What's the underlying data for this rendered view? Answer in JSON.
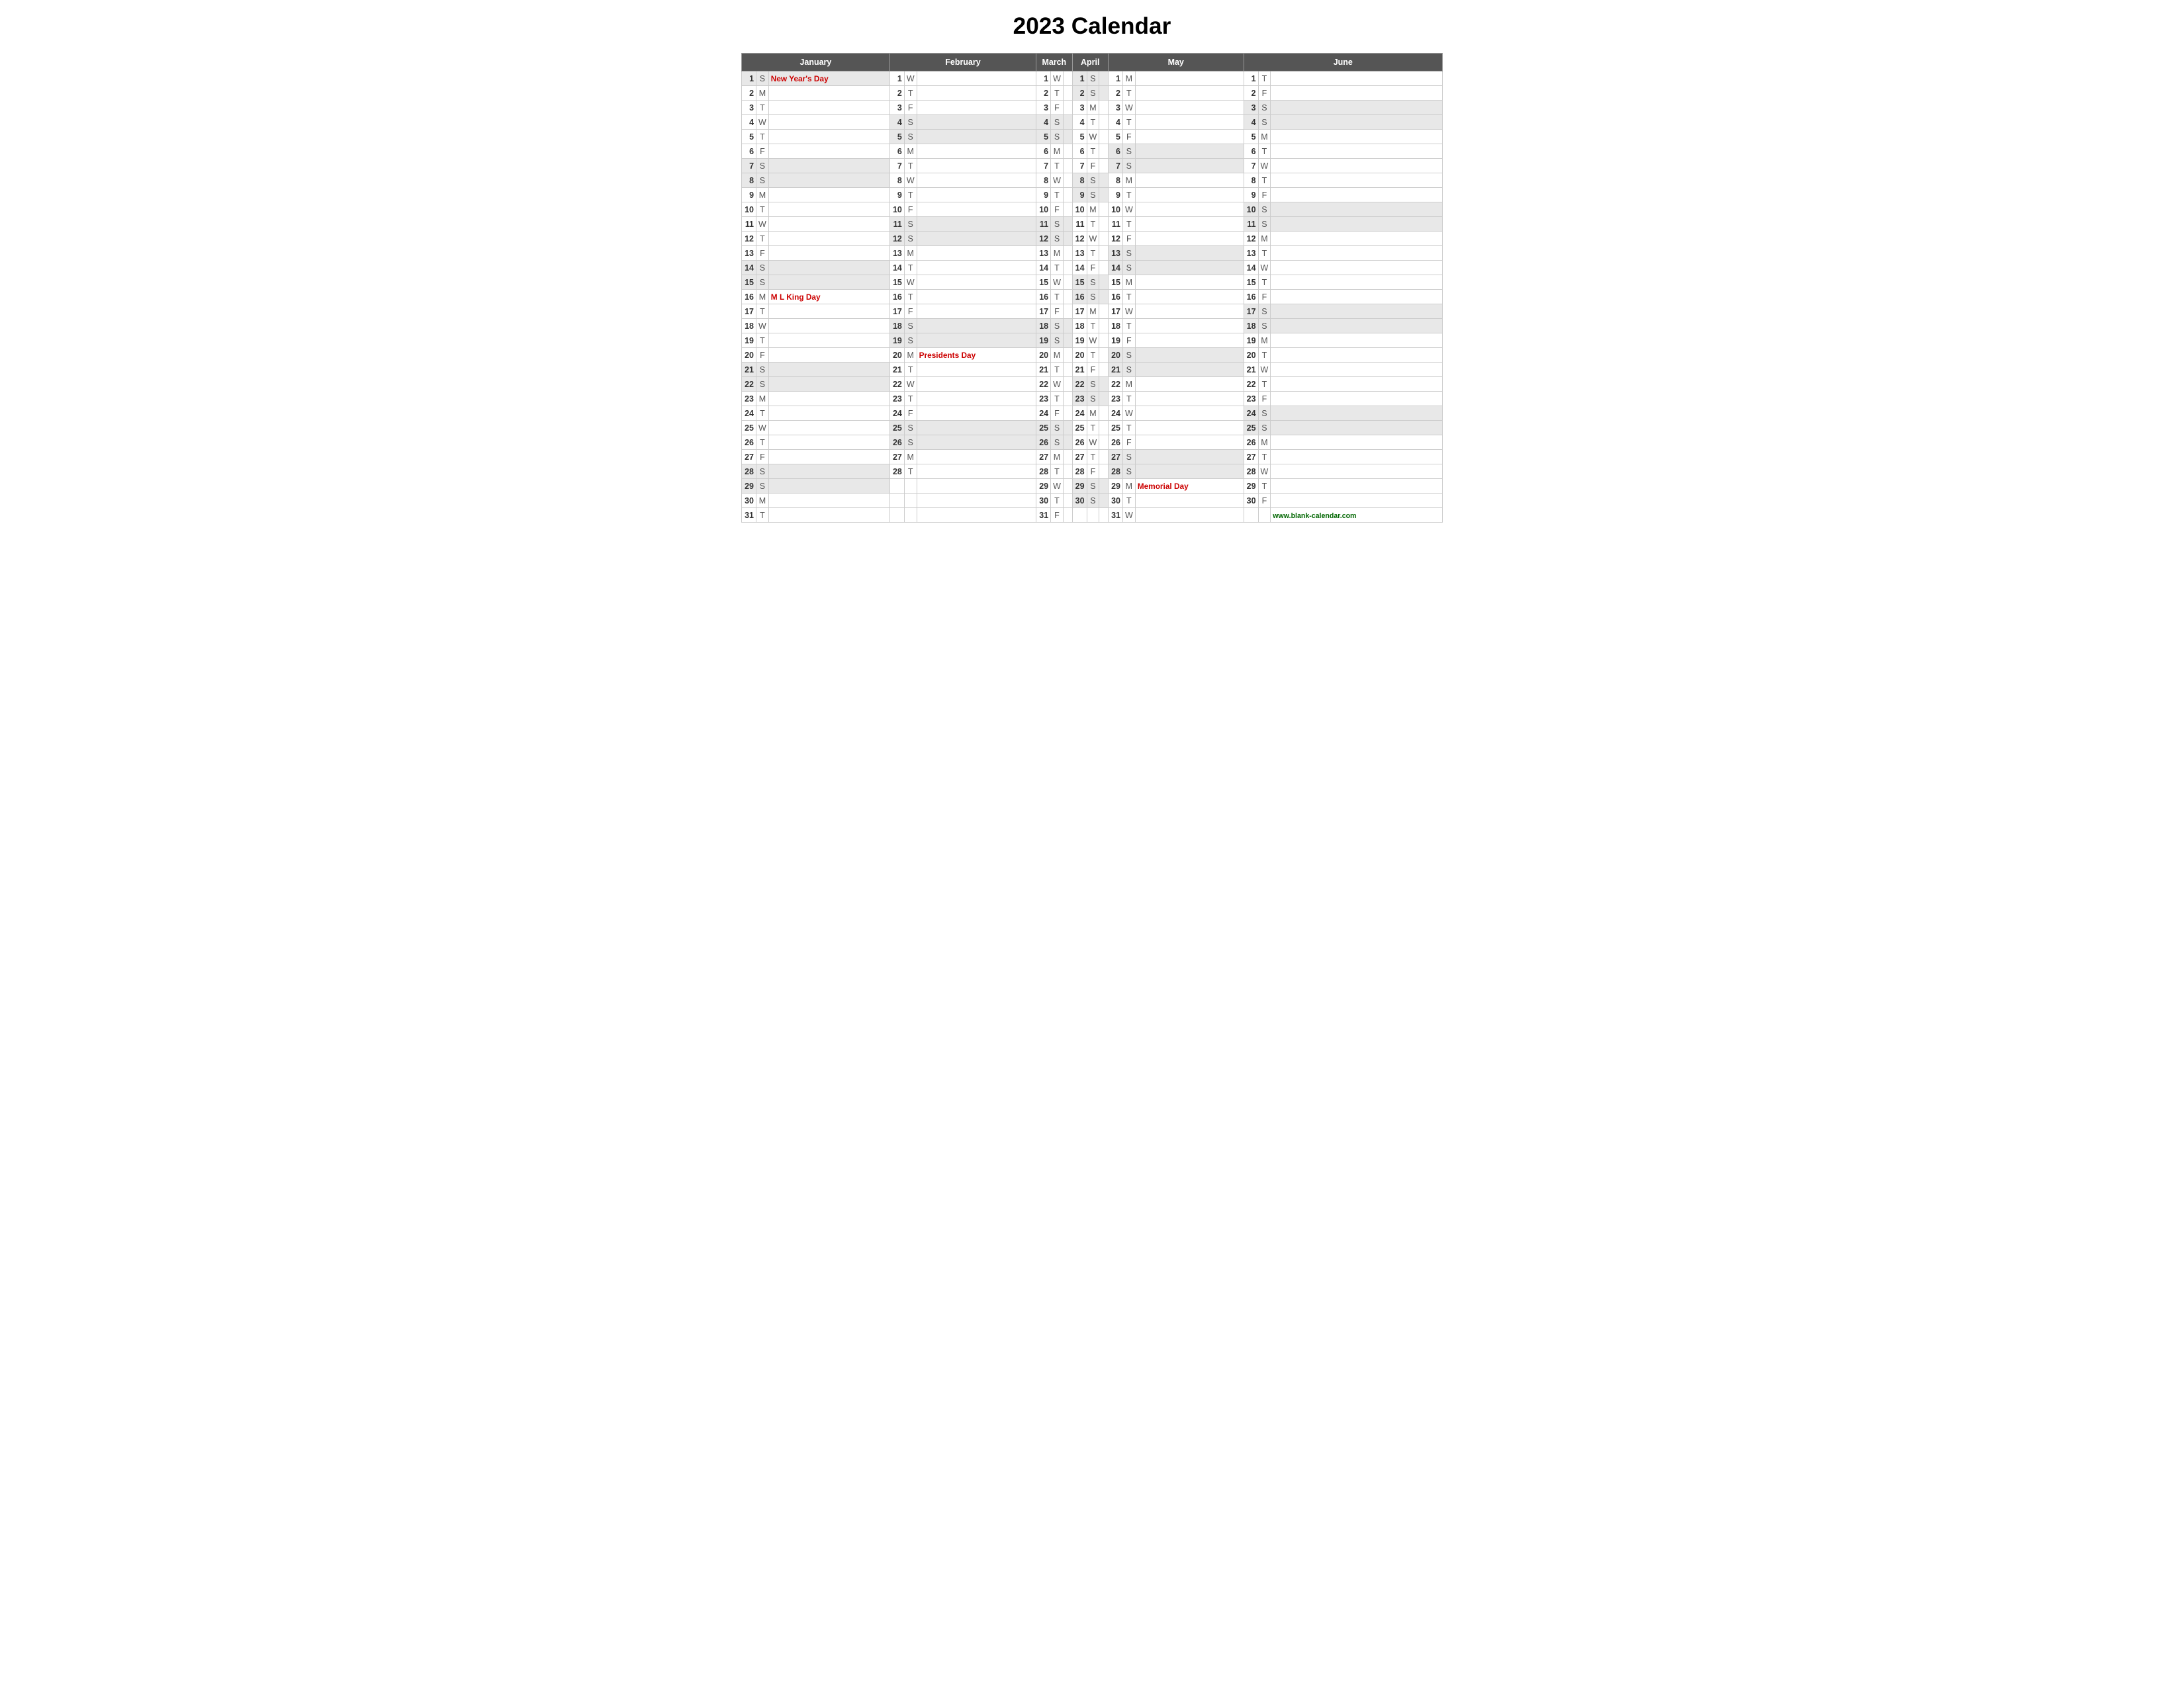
{
  "title": "2023 Calendar",
  "months": [
    "January",
    "February",
    "March",
    "April",
    "May",
    "June"
  ],
  "website": "www.blank-calendar.com",
  "days": {
    "january": [
      {
        "d": 1,
        "l": "S",
        "holiday": "New Year's Day",
        "shaded": true
      },
      {
        "d": 2,
        "l": "M",
        "holiday": "",
        "shaded": false
      },
      {
        "d": 3,
        "l": "T",
        "holiday": "",
        "shaded": false
      },
      {
        "d": 4,
        "l": "W",
        "holiday": "",
        "shaded": false
      },
      {
        "d": 5,
        "l": "T",
        "holiday": "",
        "shaded": false
      },
      {
        "d": 6,
        "l": "F",
        "holiday": "",
        "shaded": false
      },
      {
        "d": 7,
        "l": "S",
        "holiday": "",
        "shaded": true
      },
      {
        "d": 8,
        "l": "S",
        "holiday": "",
        "shaded": true
      },
      {
        "d": 9,
        "l": "M",
        "holiday": "",
        "shaded": false
      },
      {
        "d": 10,
        "l": "T",
        "holiday": "",
        "shaded": false
      },
      {
        "d": 11,
        "l": "W",
        "holiday": "",
        "shaded": false
      },
      {
        "d": 12,
        "l": "T",
        "holiday": "",
        "shaded": false
      },
      {
        "d": 13,
        "l": "F",
        "holiday": "",
        "shaded": false
      },
      {
        "d": 14,
        "l": "S",
        "holiday": "",
        "shaded": true
      },
      {
        "d": 15,
        "l": "S",
        "holiday": "",
        "shaded": true
      },
      {
        "d": 16,
        "l": "M",
        "holiday": "M L King Day",
        "shaded": false
      },
      {
        "d": 17,
        "l": "T",
        "holiday": "",
        "shaded": false
      },
      {
        "d": 18,
        "l": "W",
        "holiday": "",
        "shaded": false
      },
      {
        "d": 19,
        "l": "T",
        "holiday": "",
        "shaded": false
      },
      {
        "d": 20,
        "l": "F",
        "holiday": "",
        "shaded": false
      },
      {
        "d": 21,
        "l": "S",
        "holiday": "",
        "shaded": true
      },
      {
        "d": 22,
        "l": "S",
        "holiday": "",
        "shaded": true
      },
      {
        "d": 23,
        "l": "M",
        "holiday": "",
        "shaded": false
      },
      {
        "d": 24,
        "l": "T",
        "holiday": "",
        "shaded": false
      },
      {
        "d": 25,
        "l": "W",
        "holiday": "",
        "shaded": false
      },
      {
        "d": 26,
        "l": "T",
        "holiday": "",
        "shaded": false
      },
      {
        "d": 27,
        "l": "F",
        "holiday": "",
        "shaded": false
      },
      {
        "d": 28,
        "l": "S",
        "holiday": "",
        "shaded": true
      },
      {
        "d": 29,
        "l": "S",
        "holiday": "",
        "shaded": true
      },
      {
        "d": 30,
        "l": "M",
        "holiday": "",
        "shaded": false
      },
      {
        "d": 31,
        "l": "T",
        "holiday": "",
        "shaded": false
      }
    ],
    "february": [
      {
        "d": 1,
        "l": "W",
        "holiday": "",
        "shaded": false
      },
      {
        "d": 2,
        "l": "T",
        "holiday": "",
        "shaded": false
      },
      {
        "d": 3,
        "l": "F",
        "holiday": "",
        "shaded": false
      },
      {
        "d": 4,
        "l": "S",
        "holiday": "",
        "shaded": true
      },
      {
        "d": 5,
        "l": "S",
        "holiday": "",
        "shaded": true
      },
      {
        "d": 6,
        "l": "M",
        "holiday": "",
        "shaded": false
      },
      {
        "d": 7,
        "l": "T",
        "holiday": "",
        "shaded": false
      },
      {
        "d": 8,
        "l": "W",
        "holiday": "",
        "shaded": false
      },
      {
        "d": 9,
        "l": "T",
        "holiday": "",
        "shaded": false
      },
      {
        "d": 10,
        "l": "F",
        "holiday": "",
        "shaded": false
      },
      {
        "d": 11,
        "l": "S",
        "holiday": "",
        "shaded": true
      },
      {
        "d": 12,
        "l": "S",
        "holiday": "",
        "shaded": true
      },
      {
        "d": 13,
        "l": "M",
        "holiday": "",
        "shaded": false
      },
      {
        "d": 14,
        "l": "T",
        "holiday": "",
        "shaded": false
      },
      {
        "d": 15,
        "l": "W",
        "holiday": "",
        "shaded": false
      },
      {
        "d": 16,
        "l": "T",
        "holiday": "",
        "shaded": false
      },
      {
        "d": 17,
        "l": "F",
        "holiday": "",
        "shaded": false
      },
      {
        "d": 18,
        "l": "S",
        "holiday": "",
        "shaded": true
      },
      {
        "d": 19,
        "l": "S",
        "holiday": "",
        "shaded": true
      },
      {
        "d": 20,
        "l": "M",
        "holiday": "Presidents Day",
        "shaded": false
      },
      {
        "d": 21,
        "l": "T",
        "holiday": "",
        "shaded": false
      },
      {
        "d": 22,
        "l": "W",
        "holiday": "",
        "shaded": false
      },
      {
        "d": 23,
        "l": "T",
        "holiday": "",
        "shaded": false
      },
      {
        "d": 24,
        "l": "F",
        "holiday": "",
        "shaded": false
      },
      {
        "d": 25,
        "l": "S",
        "holiday": "",
        "shaded": true
      },
      {
        "d": 26,
        "l": "S",
        "holiday": "",
        "shaded": true
      },
      {
        "d": 27,
        "l": "M",
        "holiday": "",
        "shaded": false
      },
      {
        "d": 28,
        "l": "T",
        "holiday": "",
        "shaded": false
      }
    ],
    "march": [
      {
        "d": 1,
        "l": "W",
        "holiday": "",
        "shaded": false
      },
      {
        "d": 2,
        "l": "T",
        "holiday": "",
        "shaded": false
      },
      {
        "d": 3,
        "l": "F",
        "holiday": "",
        "shaded": false
      },
      {
        "d": 4,
        "l": "S",
        "holiday": "",
        "shaded": true
      },
      {
        "d": 5,
        "l": "S",
        "holiday": "",
        "shaded": true
      },
      {
        "d": 6,
        "l": "M",
        "holiday": "",
        "shaded": false
      },
      {
        "d": 7,
        "l": "T",
        "holiday": "",
        "shaded": false
      },
      {
        "d": 8,
        "l": "W",
        "holiday": "",
        "shaded": false
      },
      {
        "d": 9,
        "l": "T",
        "holiday": "",
        "shaded": false
      },
      {
        "d": 10,
        "l": "F",
        "holiday": "",
        "shaded": false
      },
      {
        "d": 11,
        "l": "S",
        "holiday": "",
        "shaded": true
      },
      {
        "d": 12,
        "l": "S",
        "holiday": "",
        "shaded": true
      },
      {
        "d": 13,
        "l": "M",
        "holiday": "",
        "shaded": false
      },
      {
        "d": 14,
        "l": "T",
        "holiday": "",
        "shaded": false
      },
      {
        "d": 15,
        "l": "W",
        "holiday": "",
        "shaded": false
      },
      {
        "d": 16,
        "l": "T",
        "holiday": "",
        "shaded": false
      },
      {
        "d": 17,
        "l": "F",
        "holiday": "",
        "shaded": false
      },
      {
        "d": 18,
        "l": "S",
        "holiday": "",
        "shaded": true
      },
      {
        "d": 19,
        "l": "S",
        "holiday": "",
        "shaded": true
      },
      {
        "d": 20,
        "l": "M",
        "holiday": "",
        "shaded": false
      },
      {
        "d": 21,
        "l": "T",
        "holiday": "",
        "shaded": false
      },
      {
        "d": 22,
        "l": "W",
        "holiday": "",
        "shaded": false
      },
      {
        "d": 23,
        "l": "T",
        "holiday": "",
        "shaded": false
      },
      {
        "d": 24,
        "l": "F",
        "holiday": "",
        "shaded": false
      },
      {
        "d": 25,
        "l": "S",
        "holiday": "",
        "shaded": true
      },
      {
        "d": 26,
        "l": "S",
        "holiday": "",
        "shaded": true
      },
      {
        "d": 27,
        "l": "M",
        "holiday": "",
        "shaded": false
      },
      {
        "d": 28,
        "l": "T",
        "holiday": "",
        "shaded": false
      },
      {
        "d": 29,
        "l": "W",
        "holiday": "",
        "shaded": false
      },
      {
        "d": 30,
        "l": "T",
        "holiday": "",
        "shaded": false
      },
      {
        "d": 31,
        "l": "F",
        "holiday": "",
        "shaded": false
      }
    ],
    "april": [
      {
        "d": 1,
        "l": "S",
        "holiday": "",
        "shaded": true
      },
      {
        "d": 2,
        "l": "S",
        "holiday": "",
        "shaded": true
      },
      {
        "d": 3,
        "l": "M",
        "holiday": "",
        "shaded": false
      },
      {
        "d": 4,
        "l": "T",
        "holiday": "",
        "shaded": false
      },
      {
        "d": 5,
        "l": "W",
        "holiday": "",
        "shaded": false
      },
      {
        "d": 6,
        "l": "T",
        "holiday": "",
        "shaded": false
      },
      {
        "d": 7,
        "l": "F",
        "holiday": "",
        "shaded": false
      },
      {
        "d": 8,
        "l": "S",
        "holiday": "",
        "shaded": true
      },
      {
        "d": 9,
        "l": "S",
        "holiday": "",
        "shaded": true
      },
      {
        "d": 10,
        "l": "M",
        "holiday": "",
        "shaded": false
      },
      {
        "d": 11,
        "l": "T",
        "holiday": "",
        "shaded": false
      },
      {
        "d": 12,
        "l": "W",
        "holiday": "",
        "shaded": false
      },
      {
        "d": 13,
        "l": "T",
        "holiday": "",
        "shaded": false
      },
      {
        "d": 14,
        "l": "F",
        "holiday": "",
        "shaded": false
      },
      {
        "d": 15,
        "l": "S",
        "holiday": "",
        "shaded": true
      },
      {
        "d": 16,
        "l": "S",
        "holiday": "",
        "shaded": true
      },
      {
        "d": 17,
        "l": "M",
        "holiday": "",
        "shaded": false
      },
      {
        "d": 18,
        "l": "T",
        "holiday": "",
        "shaded": false
      },
      {
        "d": 19,
        "l": "W",
        "holiday": "",
        "shaded": false
      },
      {
        "d": 20,
        "l": "T",
        "holiday": "",
        "shaded": false
      },
      {
        "d": 21,
        "l": "F",
        "holiday": "",
        "shaded": false
      },
      {
        "d": 22,
        "l": "S",
        "holiday": "",
        "shaded": true
      },
      {
        "d": 23,
        "l": "S",
        "holiday": "",
        "shaded": true
      },
      {
        "d": 24,
        "l": "M",
        "holiday": "",
        "shaded": false
      },
      {
        "d": 25,
        "l": "T",
        "holiday": "",
        "shaded": false
      },
      {
        "d": 26,
        "l": "W",
        "holiday": "",
        "shaded": false
      },
      {
        "d": 27,
        "l": "T",
        "holiday": "",
        "shaded": false
      },
      {
        "d": 28,
        "l": "F",
        "holiday": "",
        "shaded": false
      },
      {
        "d": 29,
        "l": "S",
        "holiday": "",
        "shaded": true
      },
      {
        "d": 30,
        "l": "S",
        "holiday": "",
        "shaded": true
      }
    ],
    "may": [
      {
        "d": 1,
        "l": "M",
        "holiday": "",
        "shaded": false
      },
      {
        "d": 2,
        "l": "T",
        "holiday": "",
        "shaded": false
      },
      {
        "d": 3,
        "l": "W",
        "holiday": "",
        "shaded": false
      },
      {
        "d": 4,
        "l": "T",
        "holiday": "",
        "shaded": false
      },
      {
        "d": 5,
        "l": "F",
        "holiday": "",
        "shaded": false
      },
      {
        "d": 6,
        "l": "S",
        "holiday": "",
        "shaded": true
      },
      {
        "d": 7,
        "l": "S",
        "holiday": "",
        "shaded": true
      },
      {
        "d": 8,
        "l": "M",
        "holiday": "",
        "shaded": false
      },
      {
        "d": 9,
        "l": "T",
        "holiday": "",
        "shaded": false
      },
      {
        "d": 10,
        "l": "W",
        "holiday": "",
        "shaded": false
      },
      {
        "d": 11,
        "l": "T",
        "holiday": "",
        "shaded": false
      },
      {
        "d": 12,
        "l": "F",
        "holiday": "",
        "shaded": false
      },
      {
        "d": 13,
        "l": "S",
        "holiday": "",
        "shaded": true
      },
      {
        "d": 14,
        "l": "S",
        "holiday": "",
        "shaded": true
      },
      {
        "d": 15,
        "l": "M",
        "holiday": "",
        "shaded": false
      },
      {
        "d": 16,
        "l": "T",
        "holiday": "",
        "shaded": false
      },
      {
        "d": 17,
        "l": "W",
        "holiday": "",
        "shaded": false
      },
      {
        "d": 18,
        "l": "T",
        "holiday": "",
        "shaded": false
      },
      {
        "d": 19,
        "l": "F",
        "holiday": "",
        "shaded": false
      },
      {
        "d": 20,
        "l": "S",
        "holiday": "",
        "shaded": true
      },
      {
        "d": 21,
        "l": "S",
        "holiday": "",
        "shaded": true
      },
      {
        "d": 22,
        "l": "M",
        "holiday": "",
        "shaded": false
      },
      {
        "d": 23,
        "l": "T",
        "holiday": "",
        "shaded": false
      },
      {
        "d": 24,
        "l": "W",
        "holiday": "",
        "shaded": false
      },
      {
        "d": 25,
        "l": "T",
        "holiday": "",
        "shaded": false
      },
      {
        "d": 26,
        "l": "F",
        "holiday": "",
        "shaded": false
      },
      {
        "d": 27,
        "l": "S",
        "holiday": "",
        "shaded": true
      },
      {
        "d": 28,
        "l": "S",
        "holiday": "",
        "shaded": true
      },
      {
        "d": 29,
        "l": "M",
        "holiday": "Memorial Day",
        "shaded": false
      },
      {
        "d": 30,
        "l": "T",
        "holiday": "",
        "shaded": false
      },
      {
        "d": 31,
        "l": "W",
        "holiday": "",
        "shaded": false
      }
    ],
    "june": [
      {
        "d": 1,
        "l": "T",
        "holiday": "",
        "shaded": false
      },
      {
        "d": 2,
        "l": "F",
        "holiday": "",
        "shaded": false
      },
      {
        "d": 3,
        "l": "S",
        "holiday": "",
        "shaded": true
      },
      {
        "d": 4,
        "l": "S",
        "holiday": "",
        "shaded": true
      },
      {
        "d": 5,
        "l": "M",
        "holiday": "",
        "shaded": false
      },
      {
        "d": 6,
        "l": "T",
        "holiday": "",
        "shaded": false
      },
      {
        "d": 7,
        "l": "W",
        "holiday": "",
        "shaded": false
      },
      {
        "d": 8,
        "l": "T",
        "holiday": "",
        "shaded": false
      },
      {
        "d": 9,
        "l": "F",
        "holiday": "",
        "shaded": false
      },
      {
        "d": 10,
        "l": "S",
        "holiday": "",
        "shaded": true
      },
      {
        "d": 11,
        "l": "S",
        "holiday": "",
        "shaded": true
      },
      {
        "d": 12,
        "l": "M",
        "holiday": "",
        "shaded": false
      },
      {
        "d": 13,
        "l": "T",
        "holiday": "",
        "shaded": false
      },
      {
        "d": 14,
        "l": "W",
        "holiday": "",
        "shaded": false
      },
      {
        "d": 15,
        "l": "T",
        "holiday": "",
        "shaded": false
      },
      {
        "d": 16,
        "l": "F",
        "holiday": "",
        "shaded": false
      },
      {
        "d": 17,
        "l": "S",
        "holiday": "",
        "shaded": true
      },
      {
        "d": 18,
        "l": "S",
        "holiday": "",
        "shaded": true
      },
      {
        "d": 19,
        "l": "M",
        "holiday": "",
        "shaded": false
      },
      {
        "d": 20,
        "l": "T",
        "holiday": "",
        "shaded": false
      },
      {
        "d": 21,
        "l": "W",
        "holiday": "",
        "shaded": false
      },
      {
        "d": 22,
        "l": "T",
        "holiday": "",
        "shaded": false
      },
      {
        "d": 23,
        "l": "F",
        "holiday": "",
        "shaded": false
      },
      {
        "d": 24,
        "l": "S",
        "holiday": "",
        "shaded": true
      },
      {
        "d": 25,
        "l": "S",
        "holiday": "",
        "shaded": true
      },
      {
        "d": 26,
        "l": "M",
        "holiday": "",
        "shaded": false
      },
      {
        "d": 27,
        "l": "T",
        "holiday": "",
        "shaded": false
      },
      {
        "d": 28,
        "l": "W",
        "holiday": "",
        "shaded": false
      },
      {
        "d": 29,
        "l": "T",
        "holiday": "",
        "shaded": false
      },
      {
        "d": 30,
        "l": "F",
        "holiday": "",
        "shaded": false
      }
    ]
  }
}
